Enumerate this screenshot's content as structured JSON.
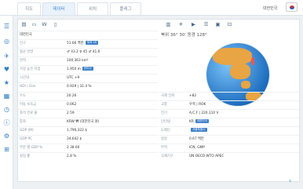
{
  "tabs": [
    "지도",
    "데이터",
    "위치",
    "플래그"
  ],
  "country": "대한민국",
  "coords": "북위 36° 30' 동경 128°",
  "left_rows": [
    {
      "k": "대한민국",
      "v": ""
    },
    {
      "k": "인구",
      "v": "51.66 백만",
      "badge": "세계 28"
    },
    {
      "k": "평균 연령",
      "v": "♂ 43.2   ♀ 45   ♂ 41.6"
    },
    {
      "k": "면적",
      "v": "100,363 km²"
    },
    {
      "k": "가장 높은 지점",
      "v": "1,950 m",
      "badge": "한라산"
    },
    {
      "k": "시간대",
      "v": "UTC +9"
    },
    {
      "k": "HDI / Gini",
      "v": "0.929 | 31.4 %",
      "green": true
    },
    {
      "k": "수도",
      "v": "20.26"
    },
    {
      "k": "이동 보조금",
      "v": "0.062"
    },
    {
      "k": "화석 연료 율",
      "v": "2.59"
    },
    {
      "k": "통화",
      "v": "KRW ₩ (대한민국 원)"
    },
    {
      "k": "GDP (M)",
      "v": "1,790,322 $"
    },
    {
      "k": "GDP PC",
      "v": "34,642 $"
    },
    {
      "k": "부문 별 GDP %",
      "v": "2   38   60"
    },
    {
      "k": "실업 률",
      "v": "2.8 %"
    }
  ],
  "right_rows": [
    {
      "k": "국제 전화",
      "v": "+82"
    },
    {
      "k": "교통",
      "v": "우측 | ROK"
    },
    {
      "k": "전기",
      "v": "A,C,F | 220,110 V"
    },
    {
      "k": "인터넷",
      "v": "KR",
      "badge": "대한민국"
    },
    {
      "k": "도메인",
      "v": "",
      "badge": "서울특별시"
    },
    {
      "k": "성장",
      "v": "0.67 백만"
    },
    {
      "k": "무역",
      "v": "ICN, GMP"
    },
    {
      "k": "국제기구",
      "v": "UN  OECD  WTO  APEC"
    }
  ],
  "sidebar_icons": [
    "list-icon",
    "controller-icon",
    "compass-icon",
    "heart-icon",
    "star-icon",
    "table-icon",
    "clock-icon",
    "info-icon",
    "settings-icon",
    "grid-icon"
  ],
  "toolbar_icons": [
    "chart-icon",
    "book-icon",
    "wiki-icon",
    "doc-icon",
    "bar-chart-icon",
    "pin-icon",
    "video-icon",
    "library-icon",
    "image-icon",
    "expand-icon"
  ]
}
